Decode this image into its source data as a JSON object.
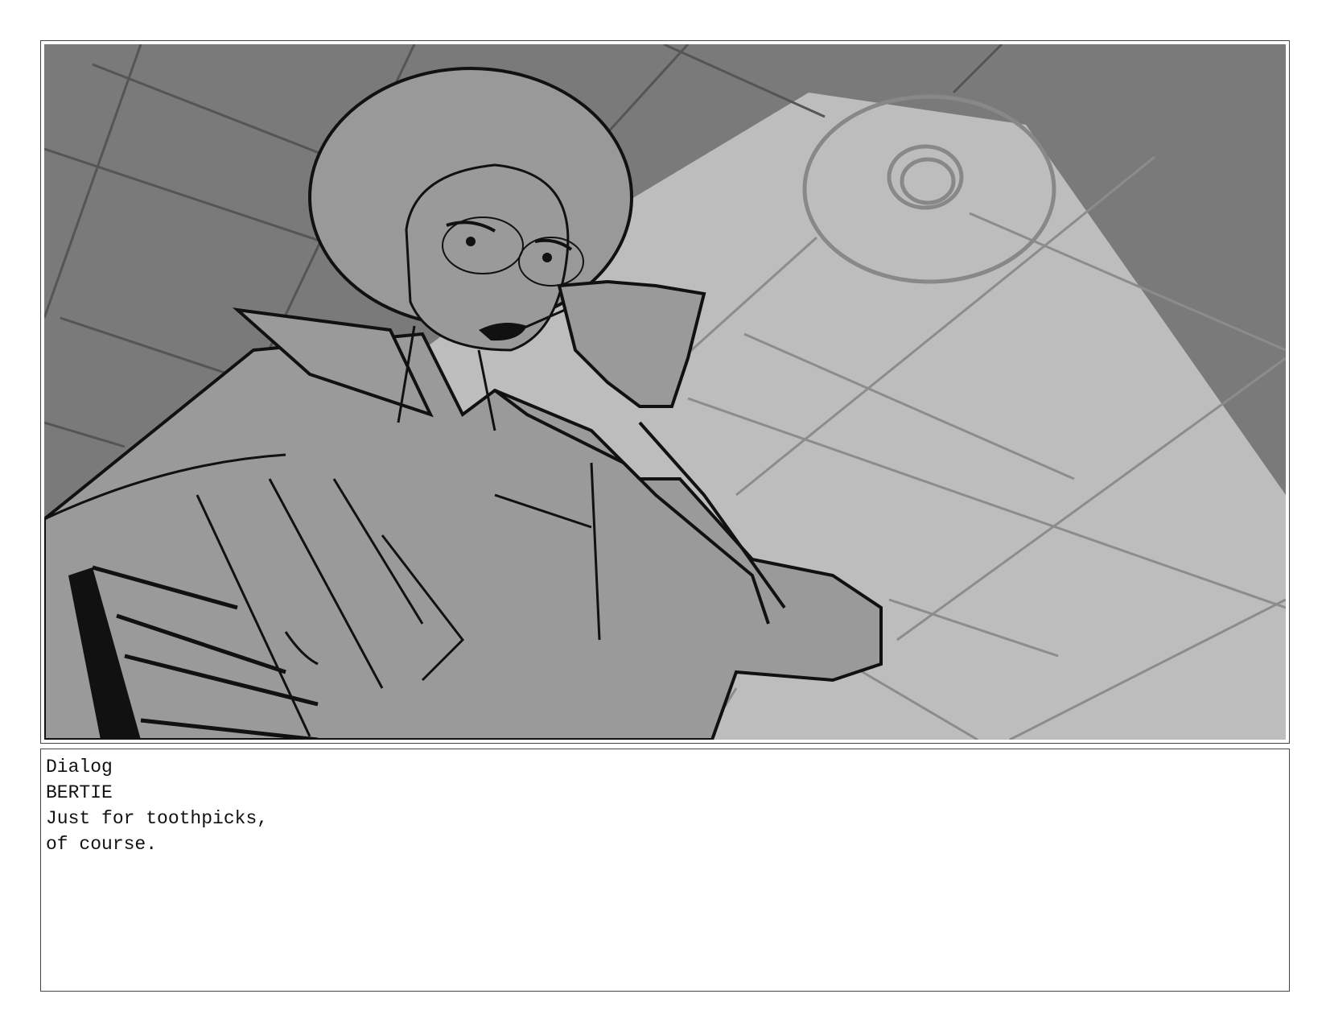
{
  "panel": {
    "scene": "ceiling-light-low-angle-character",
    "colors": {
      "ceiling_dark": "#7a7a7a",
      "light_cone": "#bdbdbd",
      "figure_fill": "#9a9a9a",
      "ink": "#111111",
      "grid_line": "#8c8c8c"
    }
  },
  "dialog": {
    "heading": "Dialog",
    "character": "BERTIE",
    "line1": "Just for toothpicks,",
    "line2": "of course."
  }
}
